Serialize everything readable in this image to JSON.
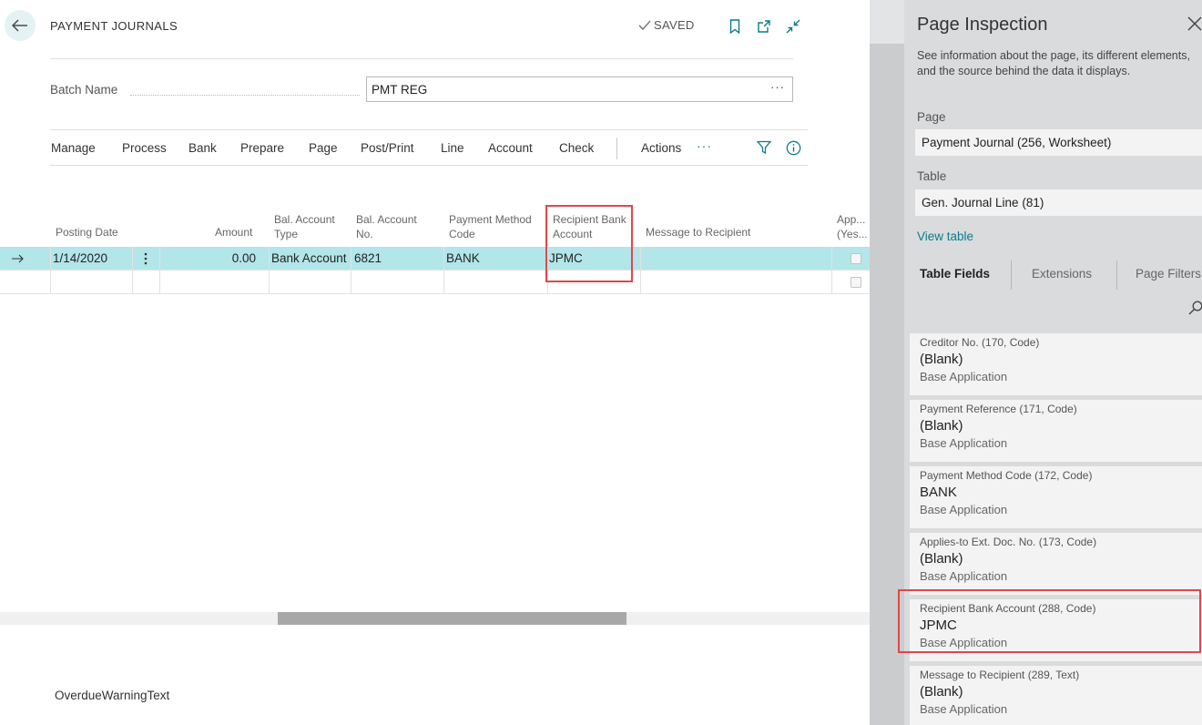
{
  "header": {
    "title": "PAYMENT JOURNALS",
    "saved_label": "SAVED"
  },
  "batch": {
    "label": "Batch Name",
    "value": "PMT REG",
    "more": "···"
  },
  "menu": {
    "items": [
      "Manage",
      "Process",
      "Bank",
      "Prepare",
      "Page",
      "Post/Print",
      "Line",
      "Account",
      "Check"
    ],
    "actions": "Actions",
    "more": "···"
  },
  "grid": {
    "columns": {
      "posting_date": "Posting Date",
      "amount": "Amount",
      "bal_account_type_1": "Bal. Account",
      "bal_account_type_2": "Type",
      "bal_account_no_1": "Bal. Account",
      "bal_account_no_2": "No.",
      "payment_method_1": "Payment Method",
      "payment_method_2": "Code",
      "recipient_bank_1": "Recipient Bank",
      "recipient_bank_2": "Account",
      "message": "Message to Recipient",
      "applies_1": "App...",
      "applies_2": "(Yes..."
    },
    "row": {
      "posting_date": "1/14/2020",
      "amount": "0.00",
      "bal_account_type": "Bank Account",
      "bal_account_no": "6821",
      "payment_method": "BANK",
      "recipient_bank": "JPMC",
      "message": ""
    }
  },
  "footer": {
    "overdue": "OverdueWarningText"
  },
  "inspection": {
    "title": "Page Inspection",
    "desc_line1": "See information about the page, its different elements,",
    "desc_line2": "and the source behind the data it displays.",
    "page_label": "Page",
    "page_value": "Payment Journal (256, Worksheet)",
    "table_label": "Table",
    "table_value": "Gen. Journal Line (81)",
    "view_table": "View table",
    "tabs": [
      "Table Fields",
      "Extensions",
      "Page Filters"
    ],
    "fields": [
      {
        "name": "Creditor No. (170, Code)",
        "value": "(Blank)",
        "source": "Base Application"
      },
      {
        "name": "Payment Reference (171, Code)",
        "value": "(Blank)",
        "source": "Base Application"
      },
      {
        "name": "Payment Method Code (172, Code)",
        "value": "BANK",
        "source": "Base Application"
      },
      {
        "name": "Applies-to Ext. Doc. No. (173, Code)",
        "value": "(Blank)",
        "source": "Base Application"
      },
      {
        "name": "Recipient Bank Account (288, Code)",
        "value": "JPMC",
        "source": "Base Application"
      },
      {
        "name": "Message to Recipient (289, Text)",
        "value": "(Blank)",
        "source": "Base Application"
      }
    ]
  },
  "colors": {
    "accent": "#0a7c8a",
    "selected_row": "#b2e6e9",
    "highlight": "#e0474c"
  }
}
